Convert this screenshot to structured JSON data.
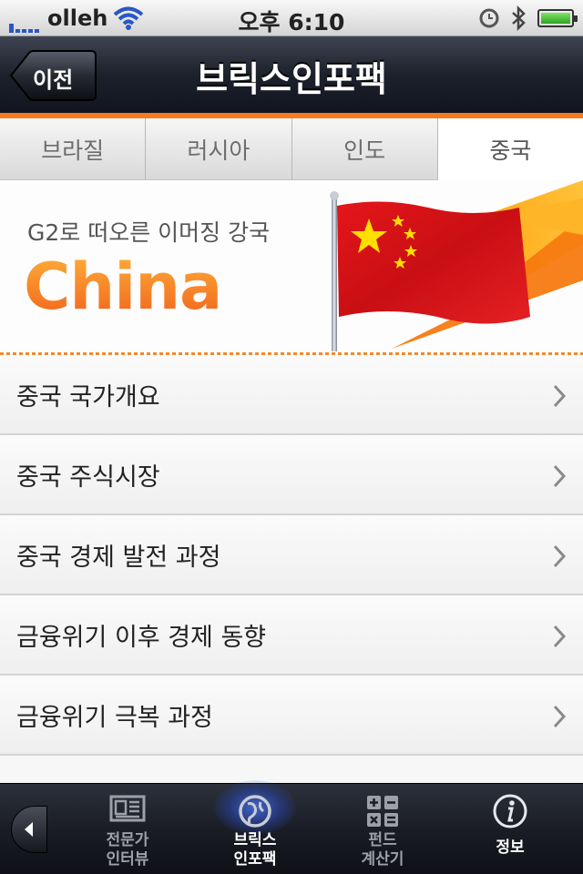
{
  "status_bar": {
    "carrier": "olleh",
    "time": "오후 6:10"
  },
  "nav": {
    "back_label": "이전",
    "title": "브릭스인포팩"
  },
  "tabs": [
    {
      "label": "브라질",
      "active": false
    },
    {
      "label": "러시아",
      "active": false
    },
    {
      "label": "인도",
      "active": false
    },
    {
      "label": "중국",
      "active": true
    }
  ],
  "banner": {
    "subtitle": "G2로 떠오른 이머징 강국",
    "title": "China",
    "flag_icon": "china-flag-icon"
  },
  "list": {
    "items": [
      {
        "label": "중국 국가개요"
      },
      {
        "label": "중국 주식시장"
      },
      {
        "label": "중국 경제 발전 과정"
      },
      {
        "label": "금융위기 이후 경제 동향"
      },
      {
        "label": "금융위기 극복 과정"
      }
    ]
  },
  "tabbar": {
    "items": [
      {
        "label": "전문가\n인터뷰",
        "icon": "newspaper-icon",
        "active": false
      },
      {
        "label": "브릭스\n인포팩",
        "icon": "globe-icon",
        "active": true
      },
      {
        "label": "펀드\n계산기",
        "icon": "calculator-icon",
        "active": false
      },
      {
        "label": "정보",
        "icon": "info-icon",
        "active": false
      }
    ]
  },
  "colors": {
    "accent": "#f47b1f",
    "nav_background": "#1d212b",
    "active_tab_glow": "#466ee6"
  }
}
